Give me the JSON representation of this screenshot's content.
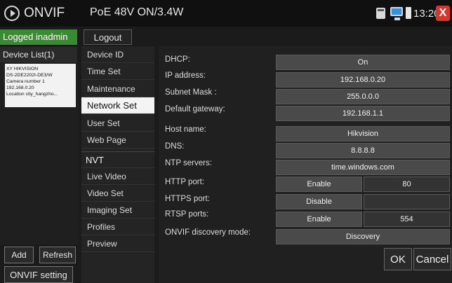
{
  "topbar": {
    "logo_text": "ONVIF",
    "power_status": "PoE 48V ON/3.4W",
    "time": "13:20",
    "close_label": "X"
  },
  "left": {
    "logged_in": "Logged inadmin",
    "device_list_label": "Device List(1)",
    "device_card": [
      "XY HIKVISION",
      "DS-2DE2202I-DE3/W",
      "Camera number 1",
      "192.168.0.20",
      "Location city_hangzho..."
    ],
    "add_label": "Add",
    "refresh_label": "Refresh",
    "onvif_setting_label": "ONVIF setting"
  },
  "logout_label": "Logout",
  "menu": [
    "Device ID",
    "Time Set",
    "Maintenance",
    "Network Set",
    "User Set",
    "Web Page",
    "NVT",
    "Live Video",
    "Video Set",
    "Imaging Set",
    "Profiles",
    "Preview"
  ],
  "network": {
    "dhcp_label": "DHCP:",
    "dhcp_value": "On",
    "ip_label": "IP address:",
    "ip_value": "192.168.0.20",
    "mask_label": "Subnet Mask :",
    "mask_value": "255.0.0.0",
    "gateway_label": "Default gateway:",
    "gateway_value": "192.168.1.1",
    "host_label": "Host name:",
    "host_value": "Hikvision",
    "dns_label": "DNS:",
    "dns_value": "8.8.8.8",
    "ntp_label": "NTP servers:",
    "ntp_value": "time.windows.com",
    "http_label": "HTTP port:",
    "http_state": "Enable",
    "http_port": "80",
    "https_label": "HTTPS port:",
    "https_state": "Disable",
    "https_port": "",
    "rtsp_label": "RTSP ports:",
    "rtsp_state": "Enable",
    "rtsp_port": "554",
    "discovery_label": "ONVIF discovery mode:",
    "discovery_value": "Discovery"
  },
  "actions": {
    "ok_label": "OK",
    "cancel_label": "Cancel"
  }
}
